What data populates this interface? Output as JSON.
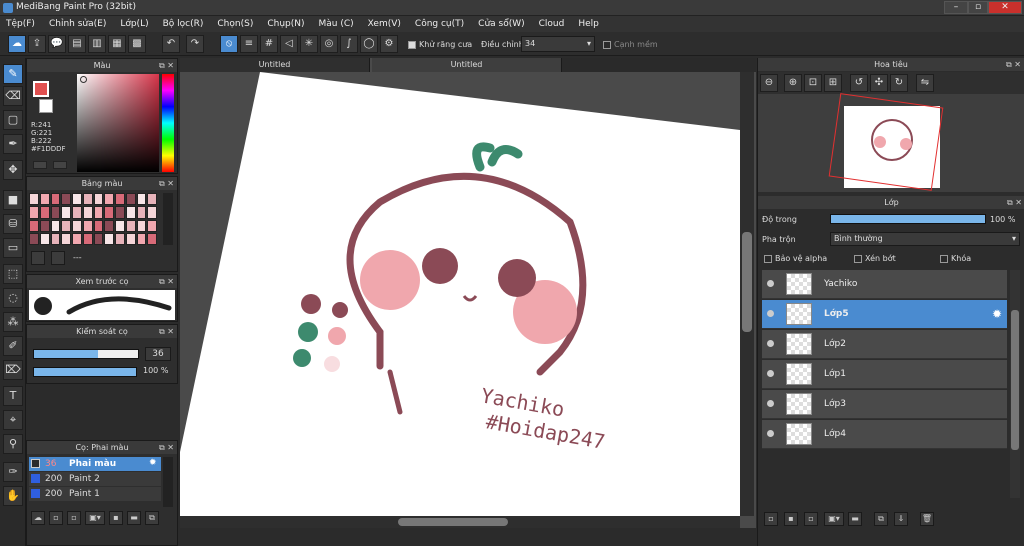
{
  "window": {
    "title": "MediBang Paint Pro (32bit)"
  },
  "menu": [
    "Tệp(F)",
    "Chỉnh sửa(E)",
    "Lớp(L)",
    "Bộ lọc(R)",
    "Chọn(S)",
    "Chụp(N)",
    "Màu (C)",
    "Xem(V)",
    "Công cụ(T)",
    "Cửa sổ(W)",
    "Cloud",
    "Help"
  ],
  "toolbar": {
    "antialias_label": "Khử răng cưa",
    "adjust_label": "Điều chỉnh",
    "adjust_value": "34",
    "snap_label": "Cạnh mềm"
  },
  "panels": {
    "color": {
      "title": "Màu",
      "r": "R:241",
      "g": "G:221",
      "b": "B:222",
      "hex": "#F1DDDF"
    },
    "palette": {
      "title": "Bảng màu",
      "footer": "---"
    },
    "brush_preview": {
      "title": "Xem trước cọ"
    },
    "brush_control": {
      "title": "Kiểm soát cọ",
      "size": "36",
      "opacity": "100 %"
    },
    "brush_list": {
      "title": "Cọ: Phai màu",
      "items": [
        {
          "size": "36",
          "name": "Phai màu",
          "color": "#2a2a2a"
        },
        {
          "size": "200",
          "name": "Paint 2",
          "color": "#2f5fe0"
        },
        {
          "size": "200",
          "name": "Paint 1",
          "color": "#2f5fe0"
        }
      ]
    }
  },
  "tabs": [
    "Untitled",
    "Untitled"
  ],
  "navigator": {
    "title": "Hoa tiêu"
  },
  "layers_panel": {
    "title": "Lớp",
    "opacity_label": "Độ trong",
    "opacity_value": "100 %",
    "opacity_level": 1.0,
    "blend_label": "Pha trộn",
    "blend_value": "Bình thường",
    "protect_alpha": "Bảo vệ alpha",
    "clipping": "Xén bớt",
    "lock": "Khóa",
    "layers": [
      {
        "name": "Yachiko",
        "selected": false
      },
      {
        "name": "Lớp5",
        "selected": true
      },
      {
        "name": "Lớp2",
        "selected": false
      },
      {
        "name": "Lớp1",
        "selected": false
      },
      {
        "name": "Lớp3",
        "selected": false
      },
      {
        "name": "Lớp4",
        "selected": false
      }
    ]
  },
  "artwork": {
    "text1": "Yachiko",
    "text2": "#Hoidap247"
  },
  "colors": {
    "accent": "#4a8bd0",
    "primary": "#F1DDDF",
    "stroke": "#8b4a56"
  }
}
